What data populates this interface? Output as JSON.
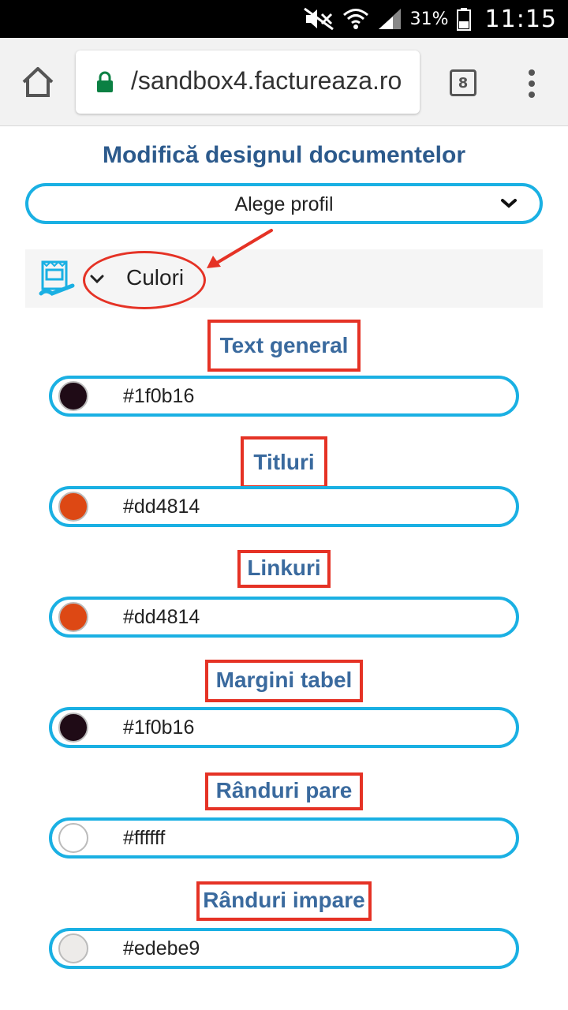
{
  "status_bar": {
    "battery_percent": "31%",
    "time": "11:15",
    "icons": [
      "mute-icon",
      "wifi-icon",
      "signal-icon",
      "battery-icon"
    ]
  },
  "browser": {
    "url": "/sandbox4.factureaza.ro",
    "tab_count": "8",
    "icons": [
      "home-icon",
      "lock-icon",
      "menu-icon"
    ]
  },
  "page": {
    "title": "Modifică designul documentelor",
    "profile_select": {
      "value": "Alege profil"
    },
    "section": {
      "label": "Culori",
      "icon": "paint-palette-icon"
    }
  },
  "colors": [
    {
      "label": "Text general",
      "value": "#1f0b16",
      "swatch": "#1f0b16"
    },
    {
      "label": "Titluri",
      "value": "#dd4814",
      "swatch": "#dd4814"
    },
    {
      "label": "Linkuri",
      "value": "#dd4814",
      "swatch": "#dd4814"
    },
    {
      "label": "Margini tabel",
      "value": "#1f0b16",
      "swatch": "#1f0b16"
    },
    {
      "label": "Rânduri pare",
      "value": "#ffffff",
      "swatch": "#ffffff"
    },
    {
      "label": "Rânduri impare",
      "value": "#edebe9",
      "swatch": "#edebe9"
    }
  ],
  "theme": {
    "accent": "#1ab0e3",
    "title_color": "#2c5a8c",
    "annotation_color": "#e53225"
  }
}
